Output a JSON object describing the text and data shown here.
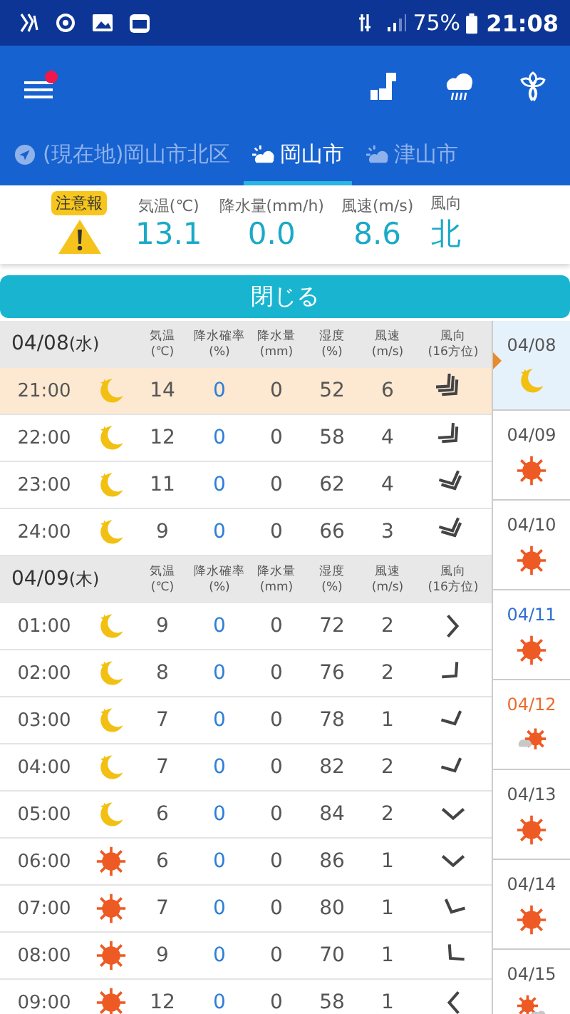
{
  "status_bar": {
    "battery": "75%",
    "time": "21:08"
  },
  "tabs": [
    {
      "label": "(現在地)岡山市北区",
      "kind": "current-location",
      "selected": false
    },
    {
      "label": "岡山市",
      "kind": "city",
      "selected": true
    },
    {
      "label": "津山市",
      "kind": "city",
      "selected": false
    }
  ],
  "current": {
    "warning": "注意報",
    "readings": [
      {
        "label": "気温(℃)",
        "value": "13.1"
      },
      {
        "label": "降水量(mm/h)",
        "value": "0.0"
      },
      {
        "label": "風速(m/s)",
        "value": "8.6"
      },
      {
        "label": "風向",
        "value": "北"
      }
    ]
  },
  "close_button": "閉じる",
  "day_groups": [
    {
      "date": "04/08",
      "weekday": "(水)",
      "columns": [
        "気温\n(℃)",
        "降水確率(%)",
        "降水量\n(mm)",
        "湿度\n(%)",
        "風速\n(m/s)",
        "風向\n(16方位)"
      ],
      "rows": [
        {
          "time": "21:00",
          "weather": {
            "kind": "moon"
          },
          "temp": "14",
          "pop": "0",
          "precip": "0",
          "humidity": "52",
          "wind": "6",
          "wind_icon": {
            "kind": "se3"
          },
          "selected": true
        },
        {
          "time": "22:00",
          "weather": {
            "kind": "moon"
          },
          "temp": "12",
          "pop": "0",
          "precip": "0",
          "humidity": "58",
          "wind": "4",
          "wind_icon": {
            "kind": "se2"
          },
          "selected": false
        },
        {
          "time": "23:00",
          "weather": {
            "kind": "moon"
          },
          "temp": "11",
          "pop": "0",
          "precip": "0",
          "humidity": "62",
          "wind": "4",
          "wind_icon": {
            "kind": "sse2"
          },
          "selected": false
        },
        {
          "time": "24:00",
          "weather": {
            "kind": "moon"
          },
          "temp": "9",
          "pop": "0",
          "precip": "0",
          "humidity": "66",
          "wind": "3",
          "wind_icon": {
            "kind": "sse2"
          },
          "selected": false
        }
      ]
    },
    {
      "date": "04/09",
      "weekday": "(木)",
      "columns": [
        "気温\n(℃)",
        "降水確率(%)",
        "降水量\n(mm)",
        "湿度\n(%)",
        "風速\n(m/s)",
        "風向\n(16方位)"
      ],
      "rows": [
        {
          "time": "01:00",
          "weather": {
            "kind": "moon"
          },
          "temp": "9",
          "pop": "0",
          "precip": "0",
          "humidity": "72",
          "wind": "2",
          "wind_icon": {
            "kind": "e1"
          },
          "selected": false
        },
        {
          "time": "02:00",
          "weather": {
            "kind": "moon"
          },
          "temp": "8",
          "pop": "0",
          "precip": "0",
          "humidity": "76",
          "wind": "2",
          "wind_icon": {
            "kind": "se1"
          },
          "selected": false
        },
        {
          "time": "03:00",
          "weather": {
            "kind": "moon"
          },
          "temp": "7",
          "pop": "0",
          "precip": "0",
          "humidity": "78",
          "wind": "1",
          "wind_icon": {
            "kind": "sse1"
          },
          "selected": false
        },
        {
          "time": "04:00",
          "weather": {
            "kind": "moon"
          },
          "temp": "7",
          "pop": "0",
          "precip": "0",
          "humidity": "82",
          "wind": "2",
          "wind_icon": {
            "kind": "sse1"
          },
          "selected": false
        },
        {
          "time": "05:00",
          "weather": {
            "kind": "moon"
          },
          "temp": "6",
          "pop": "0",
          "precip": "0",
          "humidity": "84",
          "wind": "2",
          "wind_icon": {
            "kind": "s1"
          },
          "selected": false
        },
        {
          "time": "06:00",
          "weather": {
            "kind": "sun"
          },
          "temp": "6",
          "pop": "0",
          "precip": "0",
          "humidity": "86",
          "wind": "1",
          "wind_icon": {
            "kind": "s1"
          },
          "selected": false
        },
        {
          "time": "07:00",
          "weather": {
            "kind": "sun"
          },
          "temp": "7",
          "pop": "0",
          "precip": "0",
          "humidity": "80",
          "wind": "1",
          "wind_icon": {
            "kind": "ssw1"
          },
          "selected": false
        },
        {
          "time": "08:00",
          "weather": {
            "kind": "sun"
          },
          "temp": "9",
          "pop": "0",
          "precip": "0",
          "humidity": "70",
          "wind": "1",
          "wind_icon": {
            "kind": "sw1"
          },
          "selected": false
        },
        {
          "time": "09:00",
          "weather": {
            "kind": "sun"
          },
          "temp": "12",
          "pop": "0",
          "precip": "0",
          "humidity": "58",
          "wind": "1",
          "wind_icon": {
            "kind": "w1"
          },
          "selected": false
        }
      ]
    }
  ],
  "days": [
    {
      "date": "04/08",
      "weather": {
        "kind": "moon"
      },
      "color": "#555555",
      "selected": true
    },
    {
      "date": "04/09",
      "weather": {
        "kind": "sun"
      },
      "color": "#555555",
      "selected": false
    },
    {
      "date": "04/10",
      "weather": {
        "kind": "sun"
      },
      "color": "#555555",
      "selected": false
    },
    {
      "date": "04/11",
      "weather": {
        "kind": "sun"
      },
      "color": "#2f6fd0",
      "selected": false
    },
    {
      "date": "04/12",
      "weather": {
        "kind": "cloud-sun"
      },
      "color": "#ee6a2c",
      "selected": false
    },
    {
      "date": "04/13",
      "weather": {
        "kind": "sun"
      },
      "color": "#555555",
      "selected": false
    },
    {
      "date": "04/14",
      "weather": {
        "kind": "sun"
      },
      "color": "#555555",
      "selected": false
    },
    {
      "date": "04/15",
      "weather": {
        "kind": "sun-cloud"
      },
      "color": "#555555",
      "selected": false
    }
  ]
}
